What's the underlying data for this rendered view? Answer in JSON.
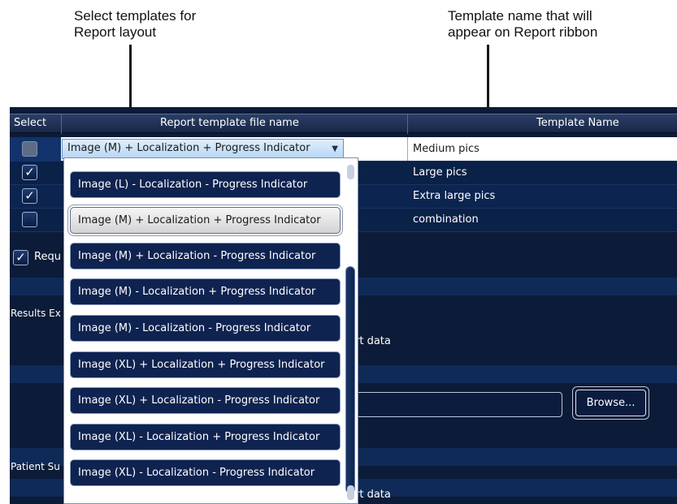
{
  "callouts": {
    "left": [
      "Select templates for",
      "Report layout"
    ],
    "right": [
      "Template name that will",
      "appear on Report ribbon"
    ]
  },
  "grid": {
    "headers": {
      "select": "Select",
      "file": "Report template file name",
      "name": "Template Name"
    },
    "rows": [
      {
        "checked": "indeterminate",
        "file": "Image (M) + Localization + Progress Indicator",
        "name": "Medium pics"
      },
      {
        "checked": "✓",
        "name": "Large pics"
      },
      {
        "checked": "✓",
        "name": "Extra large pics"
      },
      {
        "checked": "",
        "name": "combination"
      }
    ]
  },
  "require": {
    "check": "✓",
    "label": "Requ"
  },
  "sections": {
    "results": "Results Ex",
    "patient": "Patient Su"
  },
  "report_data_label": "rt data",
  "report_data_label2": "rt data",
  "browse_label": "Browse...",
  "dropdown": {
    "options": [
      "Image (L) - Localization - Progress Indicator",
      "Image (M) + Localization + Progress Indicator",
      "Image (M) + Localization - Progress Indicator",
      "Image (M) - Localization + Progress Indicator",
      "Image (M) - Localization - Progress Indicator",
      "Image (XL) + Localization + Progress Indicator",
      "Image (XL) + Localization - Progress Indicator",
      "Image (XL) - Localization + Progress Indicator",
      "Image (XL) - Localization - Progress Indicator"
    ],
    "selected_index": 1,
    "scroll_position": 0.35
  },
  "colors": {
    "panel": "#0c1b38",
    "combo": "#cfe4f9",
    "accent": "#0f2350"
  }
}
